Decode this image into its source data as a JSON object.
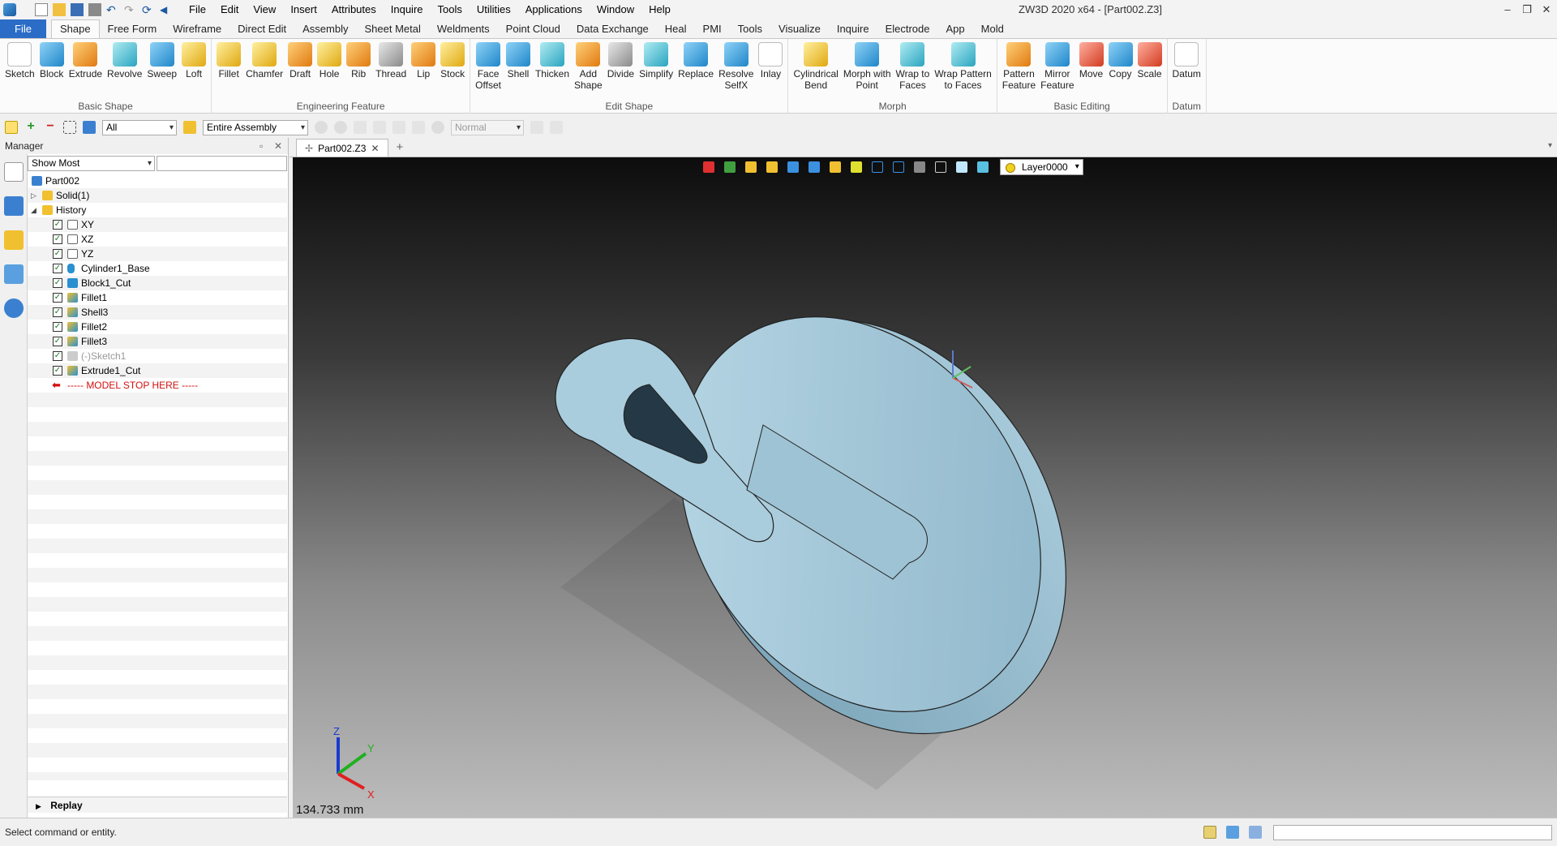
{
  "titlebar": {
    "app_title": "ZW3D 2020 x64 - [Part002.Z3]",
    "menus": [
      "File",
      "Edit",
      "View",
      "Insert",
      "Attributes",
      "Inquire",
      "Tools",
      "Utilities",
      "Applications",
      "Window",
      "Help"
    ]
  },
  "ribbon_tabs": [
    "File",
    "Shape",
    "Free Form",
    "Wireframe",
    "Direct Edit",
    "Assembly",
    "Sheet Metal",
    "Weldments",
    "Point Cloud",
    "Data Exchange",
    "Heal",
    "PMI",
    "Tools",
    "Visualize",
    "Inquire",
    "Electrode",
    "App",
    "Mold"
  ],
  "active_tab": "Shape",
  "ribbon": {
    "groups": [
      {
        "name": "Basic Shape",
        "buttons": [
          {
            "label": "Sketch",
            "icon": "sketch-icon"
          },
          {
            "label": "Block",
            "icon": "block-icon"
          },
          {
            "label": "Extrude",
            "icon": "extrude-icon"
          },
          {
            "label": "Revolve",
            "icon": "revolve-icon"
          },
          {
            "label": "Sweep",
            "icon": "sweep-icon"
          },
          {
            "label": "Loft",
            "icon": "loft-icon"
          }
        ]
      },
      {
        "name": "Engineering Feature",
        "buttons": [
          {
            "label": "Fillet",
            "icon": "fillet-icon"
          },
          {
            "label": "Chamfer",
            "icon": "chamfer-icon"
          },
          {
            "label": "Draft",
            "icon": "draft-icon"
          },
          {
            "label": "Hole",
            "icon": "hole-icon"
          },
          {
            "label": "Rib",
            "icon": "rib-icon"
          },
          {
            "label": "Thread",
            "icon": "thread-icon"
          },
          {
            "label": "Lip",
            "icon": "lip-icon"
          },
          {
            "label": "Stock",
            "icon": "stock-icon"
          }
        ]
      },
      {
        "name": "Edit Shape",
        "buttons": [
          {
            "label": "Face\nOffset",
            "icon": "face-offset-icon"
          },
          {
            "label": "Shell",
            "icon": "shell-icon"
          },
          {
            "label": "Thicken",
            "icon": "thicken-icon"
          },
          {
            "label": "Add\nShape",
            "icon": "add-shape-icon"
          },
          {
            "label": "Divide",
            "icon": "divide-icon"
          },
          {
            "label": "Simplify",
            "icon": "simplify-icon"
          },
          {
            "label": "Replace",
            "icon": "replace-icon"
          },
          {
            "label": "Resolve\nSelfX",
            "icon": "resolve-selfx-icon"
          },
          {
            "label": "Inlay",
            "icon": "inlay-icon"
          }
        ]
      },
      {
        "name": "Morph",
        "buttons": [
          {
            "label": "Cylindrical\nBend",
            "icon": "cylindrical-bend-icon"
          },
          {
            "label": "Morph with\nPoint",
            "icon": "morph-point-icon"
          },
          {
            "label": "Wrap to\nFaces",
            "icon": "wrap-faces-icon"
          },
          {
            "label": "Wrap Pattern\nto Faces",
            "icon": "wrap-pattern-icon"
          }
        ]
      },
      {
        "name": "Basic Editing",
        "buttons": [
          {
            "label": "Pattern\nFeature",
            "icon": "pattern-feature-icon"
          },
          {
            "label": "Mirror\nFeature",
            "icon": "mirror-feature-icon"
          },
          {
            "label": "Move",
            "icon": "move-icon"
          },
          {
            "label": "Copy",
            "icon": "copy-icon"
          },
          {
            "label": "Scale",
            "icon": "scale-icon"
          }
        ]
      },
      {
        "name": "Datum",
        "buttons": [
          {
            "label": "Datum",
            "icon": "datum-icon"
          }
        ]
      }
    ]
  },
  "cmdbar": {
    "filter_value": "All",
    "scope_value": "Entire Assembly",
    "mode_value": "Normal"
  },
  "manager": {
    "title": "Manager",
    "filter_value": "Show Most",
    "tree": [
      {
        "label": "Part002",
        "level": 0,
        "icon": "part-icon"
      },
      {
        "label": "Solid(1)",
        "level": 1,
        "icon": "folder-icon",
        "expander": "▷"
      },
      {
        "label": "History",
        "level": 1,
        "icon": "folder-icon",
        "expander": "◢"
      },
      {
        "label": "XY",
        "level": 2,
        "icon": "datum-plane-icon",
        "checked": true
      },
      {
        "label": "XZ",
        "level": 2,
        "icon": "datum-plane-icon",
        "checked": true
      },
      {
        "label": "YZ",
        "level": 2,
        "icon": "datum-plane-icon",
        "checked": true
      },
      {
        "label": "Cylinder1_Base",
        "level": 2,
        "icon": "cylinder-icon",
        "checked": true
      },
      {
        "label": "Block1_Cut",
        "level": 2,
        "icon": "block-icon",
        "checked": true
      },
      {
        "label": "Fillet1",
        "level": 2,
        "icon": "fillet-icon",
        "checked": true
      },
      {
        "label": "Shell3",
        "level": 2,
        "icon": "shell-icon",
        "checked": true
      },
      {
        "label": "Fillet2",
        "level": 2,
        "icon": "fillet-icon",
        "checked": true
      },
      {
        "label": "Fillet3",
        "level": 2,
        "icon": "fillet-icon",
        "checked": true
      },
      {
        "label": "(-)Sketch1",
        "level": 2,
        "icon": "sketch-icon",
        "checked": true,
        "dim": true
      },
      {
        "label": "Extrude1_Cut",
        "level": 2,
        "icon": "extrude-icon",
        "checked": true
      },
      {
        "label": "----- MODEL STOP HERE -----",
        "level": 2,
        "icon": "stop-arrow-icon",
        "stop": true
      }
    ],
    "replay_label": "Replay"
  },
  "document": {
    "tab_label": "Part002.Z3",
    "new_tab": "+"
  },
  "viewport": {
    "layer": "Layer0000",
    "scale_readout": "134.733 mm",
    "triad_labels": {
      "x": "X",
      "y": "Y",
      "z": "Z"
    }
  },
  "statusbar": {
    "text": "Select command or entity."
  },
  "colors": {
    "accent": "#2b6dc6",
    "model": "#9cc3d5",
    "stop": "#d01010"
  }
}
